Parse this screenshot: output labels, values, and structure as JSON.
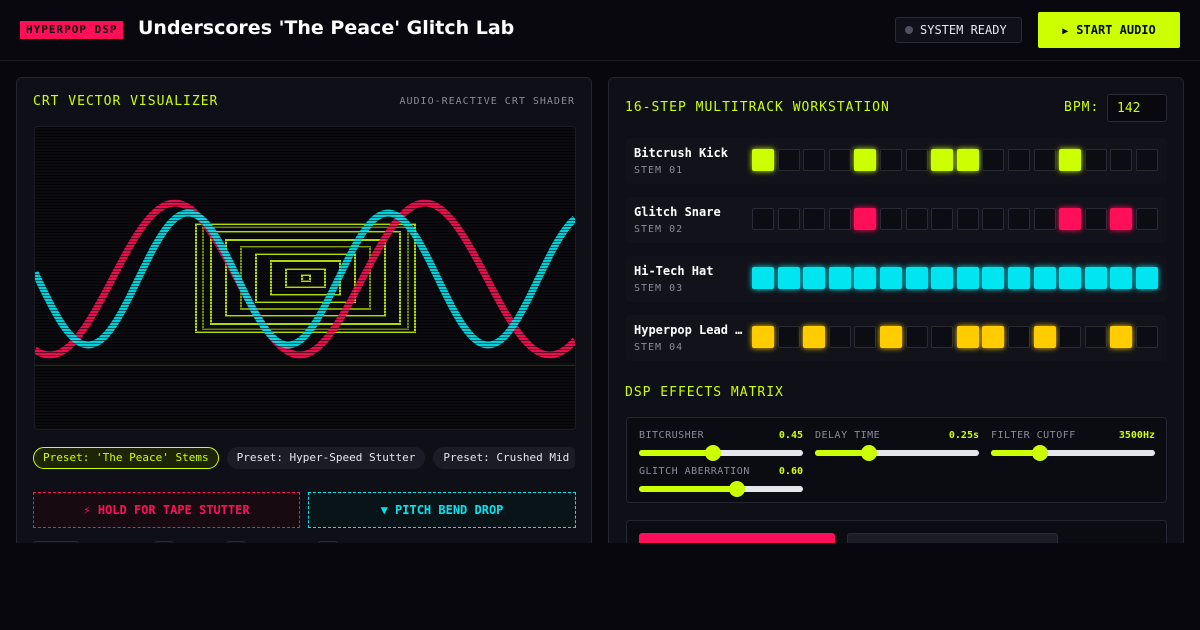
{
  "header": {
    "badge": "HYPERPOP DSP",
    "title": "Underscores 'The Peace' Glitch Lab",
    "status": "SYSTEM READY",
    "start_button": "START AUDIO",
    "colors": {
      "accent": "#ccff00",
      "brand": "#ff0f58",
      "cyan": "#00e5f0"
    }
  },
  "visualizer": {
    "title": "CRT VECTOR VISUALIZER",
    "subtitle": "AUDIO-REACTIVE CRT SHADER",
    "presets": [
      {
        "label": "Preset: 'The Peace' Stems",
        "active": true
      },
      {
        "label": "Preset: Hyper-Speed Stutter",
        "active": false
      },
      {
        "label": "Preset: Crushed Mid",
        "active": false
      }
    ],
    "stutter_button": "⚡ HOLD FOR TAPE STUTTER",
    "bend_button": "▼ PITCH BEND DROP"
  },
  "sequencer": {
    "title": "16-STEP MULTITRACK WORKSTATION",
    "bpm_label": "BPM:",
    "bpm_value": "142",
    "tracks": [
      {
        "name": "Bitcrush Kick",
        "stem": "STEM 01",
        "color": "#ccff00",
        "steps": [
          1,
          0,
          0,
          0,
          1,
          0,
          0,
          1,
          1,
          0,
          0,
          0,
          1,
          0,
          0,
          0
        ]
      },
      {
        "name": "Glitch Snare",
        "stem": "STEM 02",
        "color": "#ff0f58",
        "steps": [
          0,
          0,
          0,
          0,
          1,
          0,
          0,
          0,
          0,
          0,
          0,
          0,
          1,
          0,
          1,
          0
        ]
      },
      {
        "name": "Hi-Tech Hat",
        "stem": "STEM 03",
        "color": "#00e5f0",
        "steps": [
          1,
          1,
          1,
          1,
          1,
          1,
          1,
          1,
          1,
          1,
          1,
          1,
          1,
          1,
          1,
          1
        ]
      },
      {
        "name": "Hyperpop Lead Synth",
        "stem": "STEM 04",
        "color": "#ffcc00",
        "steps": [
          1,
          0,
          1,
          0,
          0,
          1,
          0,
          0,
          1,
          1,
          0,
          1,
          0,
          0,
          1,
          0
        ]
      }
    ]
  },
  "effects": {
    "title": "DSP EFFECTS MATRIX",
    "controls": [
      {
        "label": "BITCRUSHER",
        "value": "0.45",
        "level": 0.45
      },
      {
        "label": "DELAY TIME",
        "value": "0.25s",
        "level": 0.33
      },
      {
        "label": "FILTER CUTOFF",
        "value": "3500Hz",
        "level": 0.3
      },
      {
        "label": "GLITCH ABERRATION",
        "value": "0.60",
        "level": 0.6
      }
    ]
  }
}
